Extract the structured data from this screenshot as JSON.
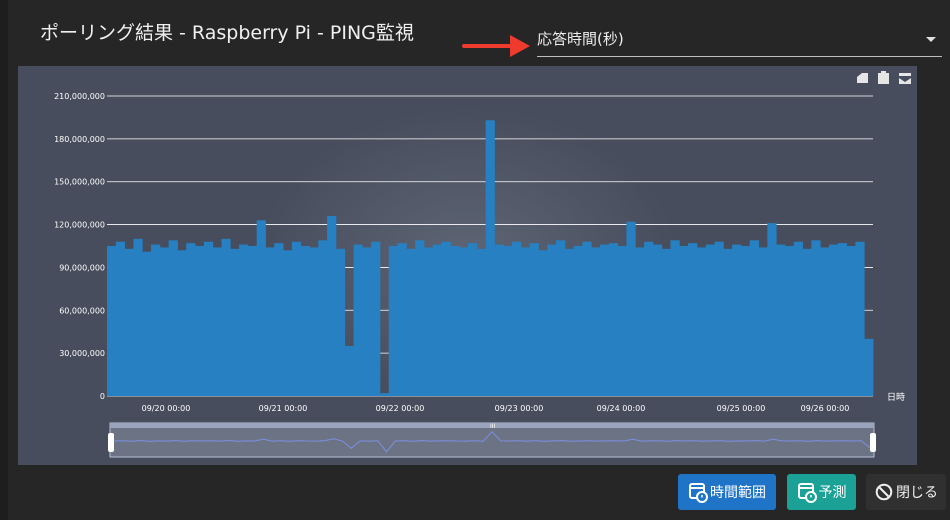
{
  "dialog": {
    "title": "ポーリング結果 - Raspberry Pi - PING監視"
  },
  "metric_select": {
    "value": "応答時間(秒)"
  },
  "toolbar_icons": [
    "restore-icon",
    "data-view-icon",
    "save-image-icon"
  ],
  "chart_data": {
    "type": "bar",
    "ylim": [
      0,
      210000000
    ],
    "y_ticks": [
      "0",
      "30,000,000",
      "60,000,000",
      "90,000,000",
      "120,000,000",
      "150,000,000",
      "180,000,000",
      "210,000,000"
    ],
    "x_tick_labels": [
      "09/20 00:00",
      "09/21 00:00",
      "09/22 00:00",
      "09/23 00:00",
      "09/24 00:00",
      "09/25 00:00",
      "09/26 00:00"
    ],
    "xlabel": "日時",
    "series": [
      {
        "values": [
          105000000,
          108000000,
          103000000,
          110000000,
          101000000,
          106000000,
          104000000,
          109000000,
          102000000,
          107000000,
          105000000,
          108000000,
          104000000,
          110000000,
          103000000,
          106000000,
          105000000,
          123000000,
          104000000,
          107000000,
          102000000,
          108000000,
          105000000,
          104000000,
          109000000,
          126000000,
          103000000,
          35000000,
          106000000,
          104000000,
          108000000,
          2000000,
          105000000,
          107000000,
          103000000,
          109000000,
          104000000,
          106000000,
          108000000,
          105000000,
          104000000,
          107000000,
          103000000,
          193000000,
          106000000,
          105000000,
          108000000,
          104000000,
          107000000,
          102000000,
          106000000,
          109000000,
          103000000,
          105000000,
          108000000,
          104000000,
          106000000,
          107000000,
          105000000,
          122000000,
          104000000,
          108000000,
          106000000,
          103000000,
          109000000,
          105000000,
          107000000,
          104000000,
          106000000,
          108000000,
          103000000,
          106000000,
          105000000,
          109000000,
          104000000,
          121000000,
          106000000,
          105000000,
          108000000,
          103000000,
          109000000,
          104000000,
          106000000,
          107000000,
          105000000,
          108000000,
          40000000
        ]
      }
    ],
    "colors": {
      "bar": "#2680c2",
      "grid": "#ffffff",
      "axis_text": "#ffffff"
    }
  },
  "zoom_slider": {
    "handle_label": "III"
  },
  "footer": {
    "time_range_label": "時間範囲",
    "forecast_label": "予測",
    "close_label": "閉じる"
  }
}
